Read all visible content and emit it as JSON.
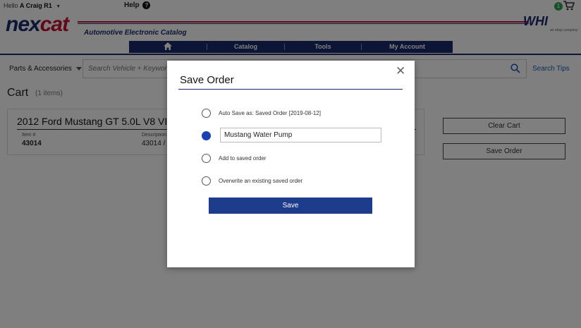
{
  "topbar": {
    "hello_prefix": "Hello",
    "user_name": "A Craig R1",
    "help_label": "Help",
    "cart_count": "1"
  },
  "header": {
    "logo_part1": "nex",
    "logo_part2": "cat",
    "tagline": "Automotive Electronic Catalog",
    "partner_logo": "WHI",
    "partner_sub": "an ebay company"
  },
  "nav": {
    "items": [
      {
        "label": "",
        "icon": "home-icon"
      },
      {
        "label": "Catalog"
      },
      {
        "label": "Tools"
      },
      {
        "label": "My Account"
      }
    ]
  },
  "search": {
    "category": "Parts & Accessories",
    "placeholder": "Search Vehicle + Keyword,",
    "tips_label": "Search Tips"
  },
  "cart": {
    "title": "Cart",
    "items_count": "(1 items)",
    "vehicle": "2012 Ford Mustang GT 5.0L V8 VIN:",
    "columns": {
      "item_label": "Item #",
      "item_value": "43014",
      "desc_label": "Description",
      "desc_value": "43014 / E"
    },
    "clear_label": "Clear Cart",
    "save_order_label": "Save Order"
  },
  "modal": {
    "title": "Save Order",
    "options": [
      {
        "label": "Auto Save as: Saved Order [2019-08-12]",
        "selected": false
      },
      {
        "label": "",
        "selected": true
      },
      {
        "label": "Add to saved order",
        "selected": false
      },
      {
        "label": "Overwrite an existing saved order",
        "selected": false
      }
    ],
    "order_name_value": "Mustang Water Pump",
    "save_label": "Save"
  },
  "colors": {
    "navy": "#1a2a6c",
    "red": "#c8102e",
    "link": "#1b5dbf",
    "save_button": "#1e3c8c",
    "radio_selected": "#1a3fb5",
    "cart_badge": "#2ea44f"
  }
}
